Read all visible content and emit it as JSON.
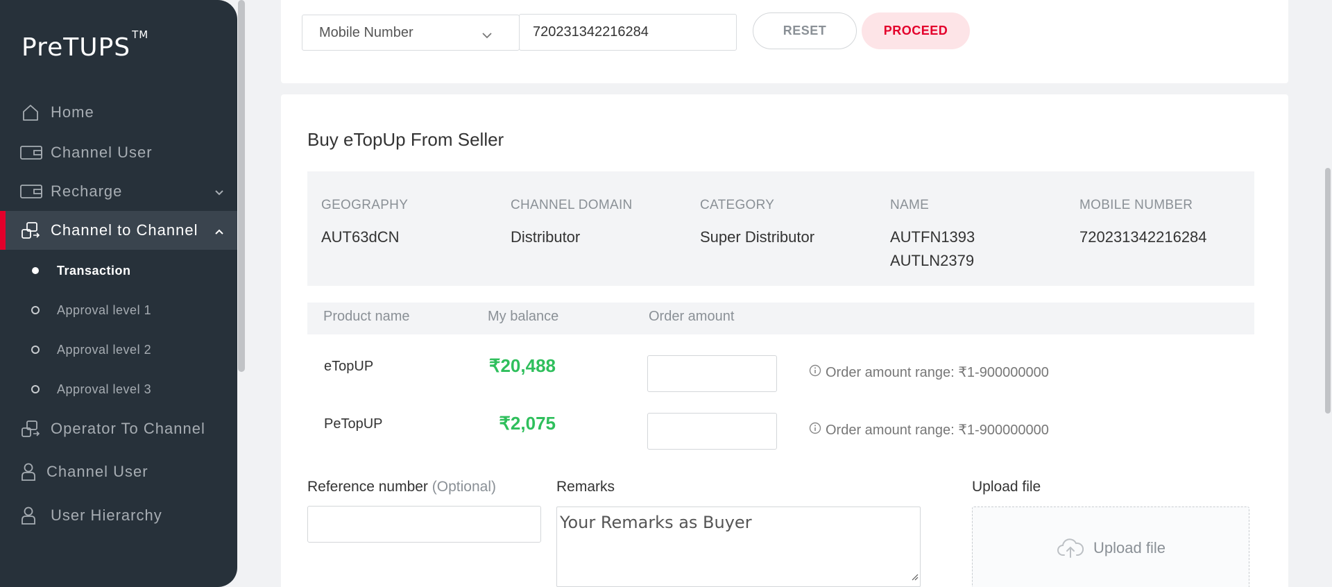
{
  "app": {
    "logo": "PreTUPS",
    "logo_mark": "TM"
  },
  "sidebar": {
    "items": [
      {
        "label": "Home",
        "icon": "home-icon"
      },
      {
        "label": "Channel User",
        "icon": "wallet-icon"
      },
      {
        "label": "Recharge",
        "icon": "wallet-icon"
      },
      {
        "label": "Channel to Channel",
        "icon": "transfer-icon"
      },
      {
        "label": "Operator To Channel",
        "icon": "transfer-icon"
      },
      {
        "label": "Channel User",
        "icon": "user-icon"
      },
      {
        "label": "User Hierarchy",
        "icon": "user-icon"
      }
    ],
    "subitems": [
      {
        "label": "Transaction"
      },
      {
        "label": "Approval level 1"
      },
      {
        "label": "Approval level 2"
      },
      {
        "label": "Approval level 3"
      }
    ],
    "active_item": "Channel to Channel",
    "active_subitem": "Transaction"
  },
  "search": {
    "type_select": "Mobile Number",
    "value": "720231342216284",
    "reset_label": "RESET",
    "proceed_label": "PROCEED"
  },
  "section": {
    "title": "Buy eTopUp From Seller"
  },
  "seller": {
    "geography_label": "GEOGRAPHY",
    "geography": "AUT63dCN",
    "domain_label": "CHANNEL DOMAIN",
    "domain": "Distributor",
    "category_label": "CATEGORY",
    "category": "Super Distributor",
    "name_label": "NAME",
    "name_line1": "AUTFN1393",
    "name_line2": "AUTLN2379",
    "mobile_label": "MOBILE NUMBER",
    "mobile": "720231342216284"
  },
  "products": {
    "headers": [
      "Product name",
      "My balance",
      "Order amount"
    ],
    "rows": [
      {
        "name": "eTopUP",
        "balance": "₹20,488",
        "range": "Order amount range: ₹1-900000000"
      },
      {
        "name": "PeTopUP",
        "balance": "₹2,075",
        "range": "Order amount range: ₹1-900000000"
      }
    ]
  },
  "form": {
    "reference_label": "Reference number",
    "reference_optional": "(Optional)",
    "remarks_label": "Remarks",
    "remarks_placeholder": "Your Remarks as Buyer",
    "upload_label": "Upload file",
    "upload_button": "Upload file"
  },
  "colors": {
    "sidebar_bg": "#27313a",
    "accent_red": "#e3002b",
    "balance_green": "#2fbf5c"
  }
}
